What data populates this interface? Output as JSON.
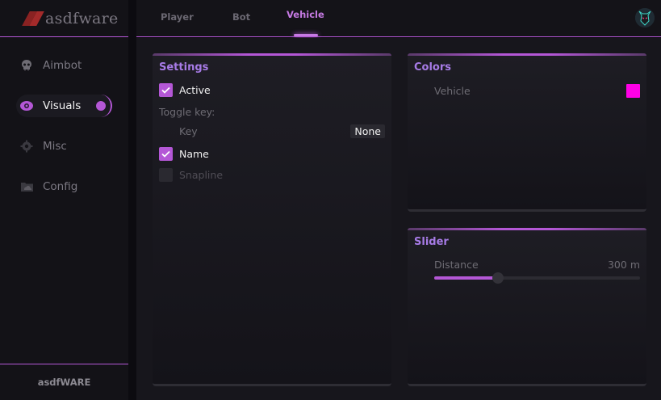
{
  "brand": {
    "name": "asdfware",
    "footer": "asdfWARE"
  },
  "colors": {
    "accent": "#b457d6",
    "tab_active": "#c67ae3",
    "vehicle_color": "#ff00e6"
  },
  "sidebar": {
    "items": [
      {
        "label": "Aimbot",
        "icon": "skull-icon"
      },
      {
        "label": "Visuals",
        "icon": "eye-icon",
        "active": true
      },
      {
        "label": "Misc",
        "icon": "gear-icon"
      },
      {
        "label": "Config",
        "icon": "folder-icon"
      }
    ]
  },
  "tabs": [
    {
      "label": "Player"
    },
    {
      "label": "Bot"
    },
    {
      "label": "Vehicle",
      "active": true
    }
  ],
  "settings": {
    "title": "Settings",
    "active_label": "Active",
    "active_checked": true,
    "toggle_key_label": "Toggle key:",
    "key_label": "Key",
    "key_value": "None",
    "name_label": "Name",
    "name_checked": true,
    "snapline_label": "Snapline",
    "snapline_checked": false
  },
  "colors_panel": {
    "title": "Colors",
    "vehicle_label": "Vehicle"
  },
  "slider_panel": {
    "title": "Slider",
    "distance_label": "Distance",
    "distance_value": "300 m",
    "distance_fraction": 0.31
  }
}
